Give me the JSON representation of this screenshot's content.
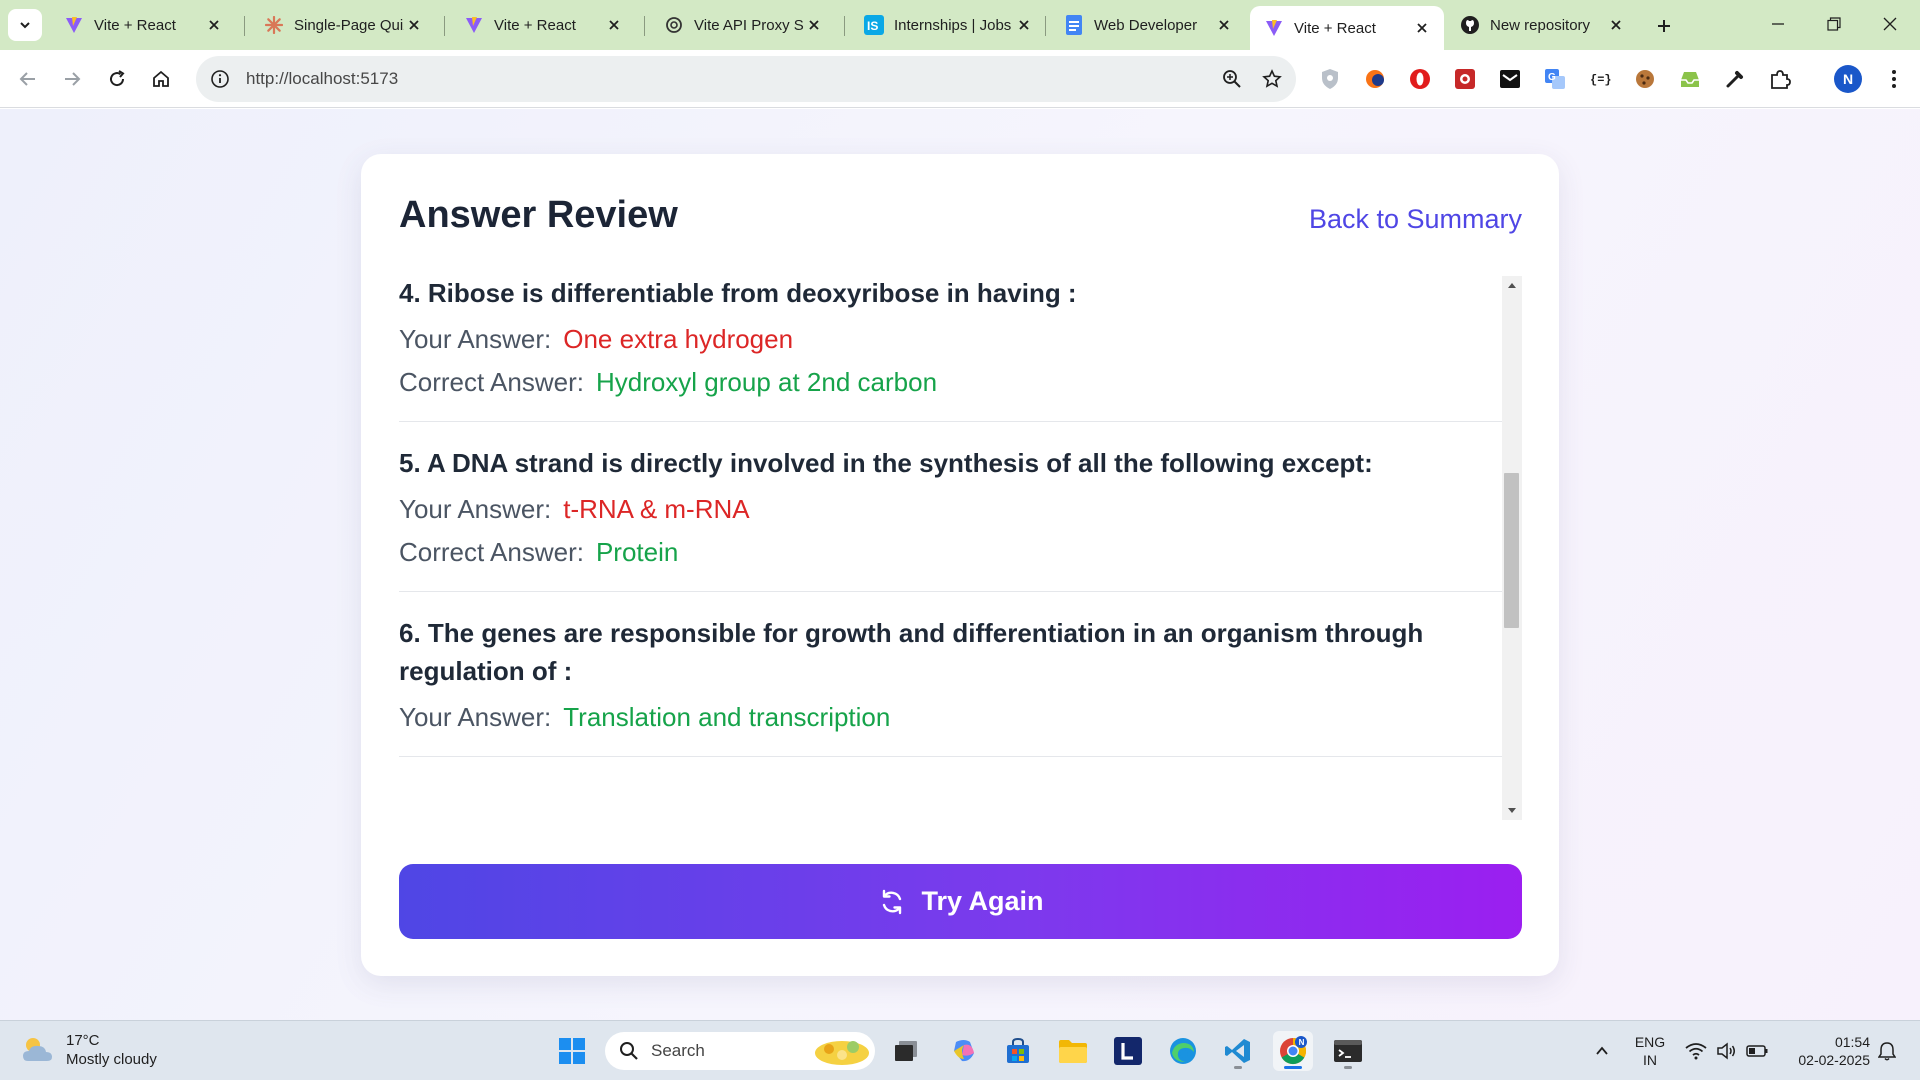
{
  "browser": {
    "tabs": [
      {
        "title": "Vite + React",
        "icon": "vite-icon"
      },
      {
        "title": "Single-Page Quiz",
        "icon": "claude-icon"
      },
      {
        "title": "Vite + React",
        "icon": "vite-icon"
      },
      {
        "title": "Vite API Proxy Se",
        "icon": "chatgpt-icon"
      },
      {
        "title": "Internships | Jobs",
        "icon": "internshala-icon"
      },
      {
        "title": "Web Developer",
        "icon": "google-docs-icon"
      },
      {
        "title": "Vite + React",
        "icon": "vite-icon",
        "active": true
      },
      {
        "title": "New repository",
        "icon": "github-icon"
      }
    ],
    "url": "http://localhost:5173",
    "profile_initial": "N"
  },
  "review": {
    "title": "Answer Review",
    "back_link": "Back to Summary",
    "your_answer_label": "Your Answer:",
    "correct_answer_label": "Correct Answer:",
    "questions": [
      {
        "text": "4. Ribose is differentiable from deoxyribose in having :",
        "your_answer": "One extra hydrogen",
        "correct_answer": "Hydroxyl group at 2nd carbon",
        "is_correct": false
      },
      {
        "text": "5. A DNA strand is directly involved in the synthesis of all the following except:",
        "your_answer": "t-RNA & m-RNA",
        "correct_answer": "Protein",
        "is_correct": false
      },
      {
        "text": "6. The genes are responsible for growth and differentiation in an organism through regulation of :",
        "your_answer": "Translation and transcription",
        "is_correct": true
      }
    ],
    "try_again_label": "Try Again"
  },
  "taskbar": {
    "weather_temp": "17°C",
    "weather_desc": "Mostly cloudy",
    "search_placeholder": "Search",
    "lang_1": "ENG",
    "lang_2": "IN",
    "time": "01:54",
    "date": "02-02-2025"
  },
  "colors": {
    "accent": "#4f46e5",
    "wrong": "#dc2626",
    "right": "#16a34a",
    "gradient_end": "#9b1ff0",
    "tabstrip": "#d3e9c5"
  }
}
